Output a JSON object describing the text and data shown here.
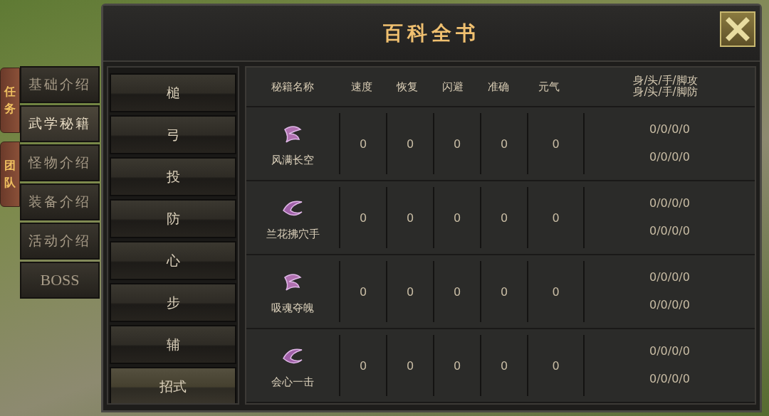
{
  "window": {
    "title": "百科全书"
  },
  "side_tabs": [
    {
      "label": "任务"
    },
    {
      "label": "团队"
    }
  ],
  "categories": [
    {
      "label": "基础介绍",
      "selected": false
    },
    {
      "label": "武学秘籍",
      "selected": true
    },
    {
      "label": "怪物介绍",
      "selected": false
    },
    {
      "label": "装备介绍",
      "selected": false
    },
    {
      "label": "活动介绍",
      "selected": false
    },
    {
      "label": "BOSS",
      "selected": false
    }
  ],
  "subcategories": [
    {
      "label": "槌",
      "selected": false
    },
    {
      "label": "弓",
      "selected": false
    },
    {
      "label": "投",
      "selected": false
    },
    {
      "label": "防",
      "selected": false
    },
    {
      "label": "心",
      "selected": false
    },
    {
      "label": "步",
      "selected": false
    },
    {
      "label": "辅",
      "selected": false
    },
    {
      "label": "招式",
      "selected": true
    }
  ],
  "table": {
    "columns": [
      "秘籍名称",
      "速度",
      "恢复",
      "闪避",
      "准确",
      "元气"
    ],
    "last_column": [
      "身/头/手/脚攻",
      "身/头/手/脚防"
    ],
    "rows": [
      {
        "name": "风满长空",
        "values": [
          "0",
          "0",
          "0",
          "0",
          "0"
        ],
        "attack": "0/0/0/0",
        "defense": "0/0/0/0"
      },
      {
        "name": "兰花拂穴手",
        "values": [
          "0",
          "0",
          "0",
          "0",
          "0"
        ],
        "attack": "0/0/0/0",
        "defense": "0/0/0/0"
      },
      {
        "name": "吸魂夺魄",
        "values": [
          "0",
          "0",
          "0",
          "0",
          "0"
        ],
        "attack": "0/0/0/0",
        "defense": "0/0/0/0"
      },
      {
        "name": "会心一击",
        "values": [
          "0",
          "0",
          "0",
          "0",
          "0"
        ],
        "attack": "0/0/0/0",
        "defense": "0/0/0/0"
      }
    ]
  }
}
